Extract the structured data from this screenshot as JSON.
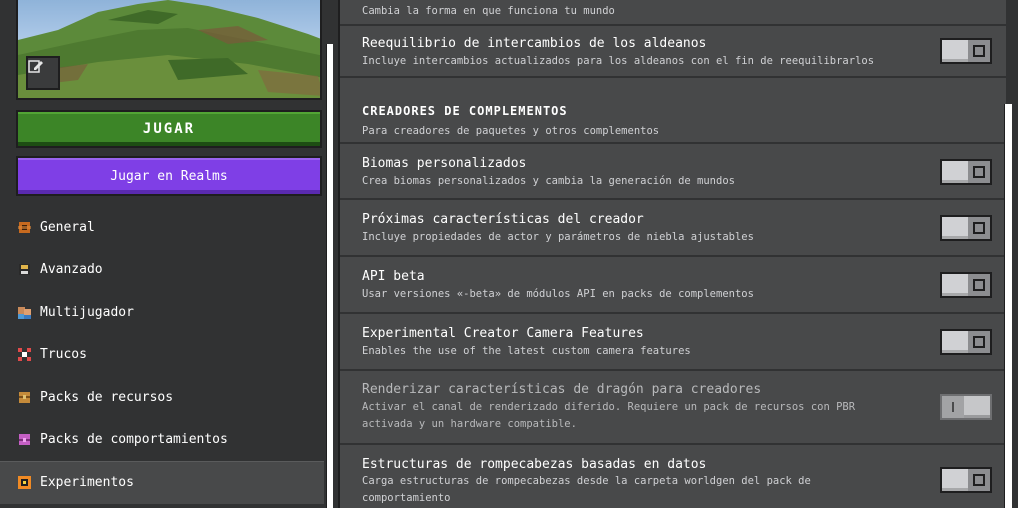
{
  "sidebar": {
    "play_label": "JUGAR",
    "realms_label": "Jugar en Realms",
    "items": [
      {
        "label": "General",
        "icon": "gear-icon",
        "color": "#c76a1f"
      },
      {
        "label": "Avanzado",
        "icon": "floppy-icon",
        "color": "#e0b44a"
      },
      {
        "label": "Multijugador",
        "icon": "players-icon",
        "color": "#4f9ad6"
      },
      {
        "label": "Trucos",
        "icon": "cheats-icon",
        "color": "#e04a4a"
      },
      {
        "label": "Packs de recursos",
        "icon": "resource-pack-icon",
        "color": "#c48a3a"
      },
      {
        "label": "Packs de comportamientos",
        "icon": "behavior-pack-icon",
        "color": "#c45fc4"
      },
      {
        "label": "Experimentos",
        "icon": "experiments-icon",
        "color": "#f08a24"
      }
    ],
    "active_index": 6
  },
  "main": {
    "top_desc": "Cambia la forma en que funciona tu mundo",
    "villager": {
      "title": "Reequilibrio de intercambios de los aldeanos",
      "desc": "Incluye intercambios actualizados para los aldeanos con el fin de reequilibrarlos",
      "enabled": false
    },
    "section": {
      "title": "CREADORES DE COMPLEMENTOS",
      "desc": "Para creadores de paquetes y otros complementos"
    },
    "rows": [
      {
        "title": "Biomas personalizados",
        "desc": "Crea biomas personalizados y cambia la generación de mundos",
        "enabled": false
      },
      {
        "title": "Próximas características del creador",
        "desc": "Incluye propiedades de actor y parámetros de niebla ajustables",
        "enabled": false
      },
      {
        "title": "API beta",
        "desc": "Usar versiones «-beta» de módulos API en packs de complementos",
        "enabled": false
      },
      {
        "title": "Experimental Creator Camera Features",
        "desc": "Enables the use of the latest custom camera features",
        "enabled": false
      },
      {
        "title": "Renderizar características de dragón para creadores",
        "desc": "Activar el canal de renderizado diferido. Requiere un pack de recursos con PBR",
        "desc2": "activada y un hardware compatible.",
        "enabled": true,
        "locked": true
      },
      {
        "title": "Estructuras de rompecabezas basadas en datos",
        "desc": "Carga estructuras de rompecabezas desde la carpeta worldgen del pack de",
        "desc2": "comportamiento",
        "enabled": false
      }
    ]
  }
}
